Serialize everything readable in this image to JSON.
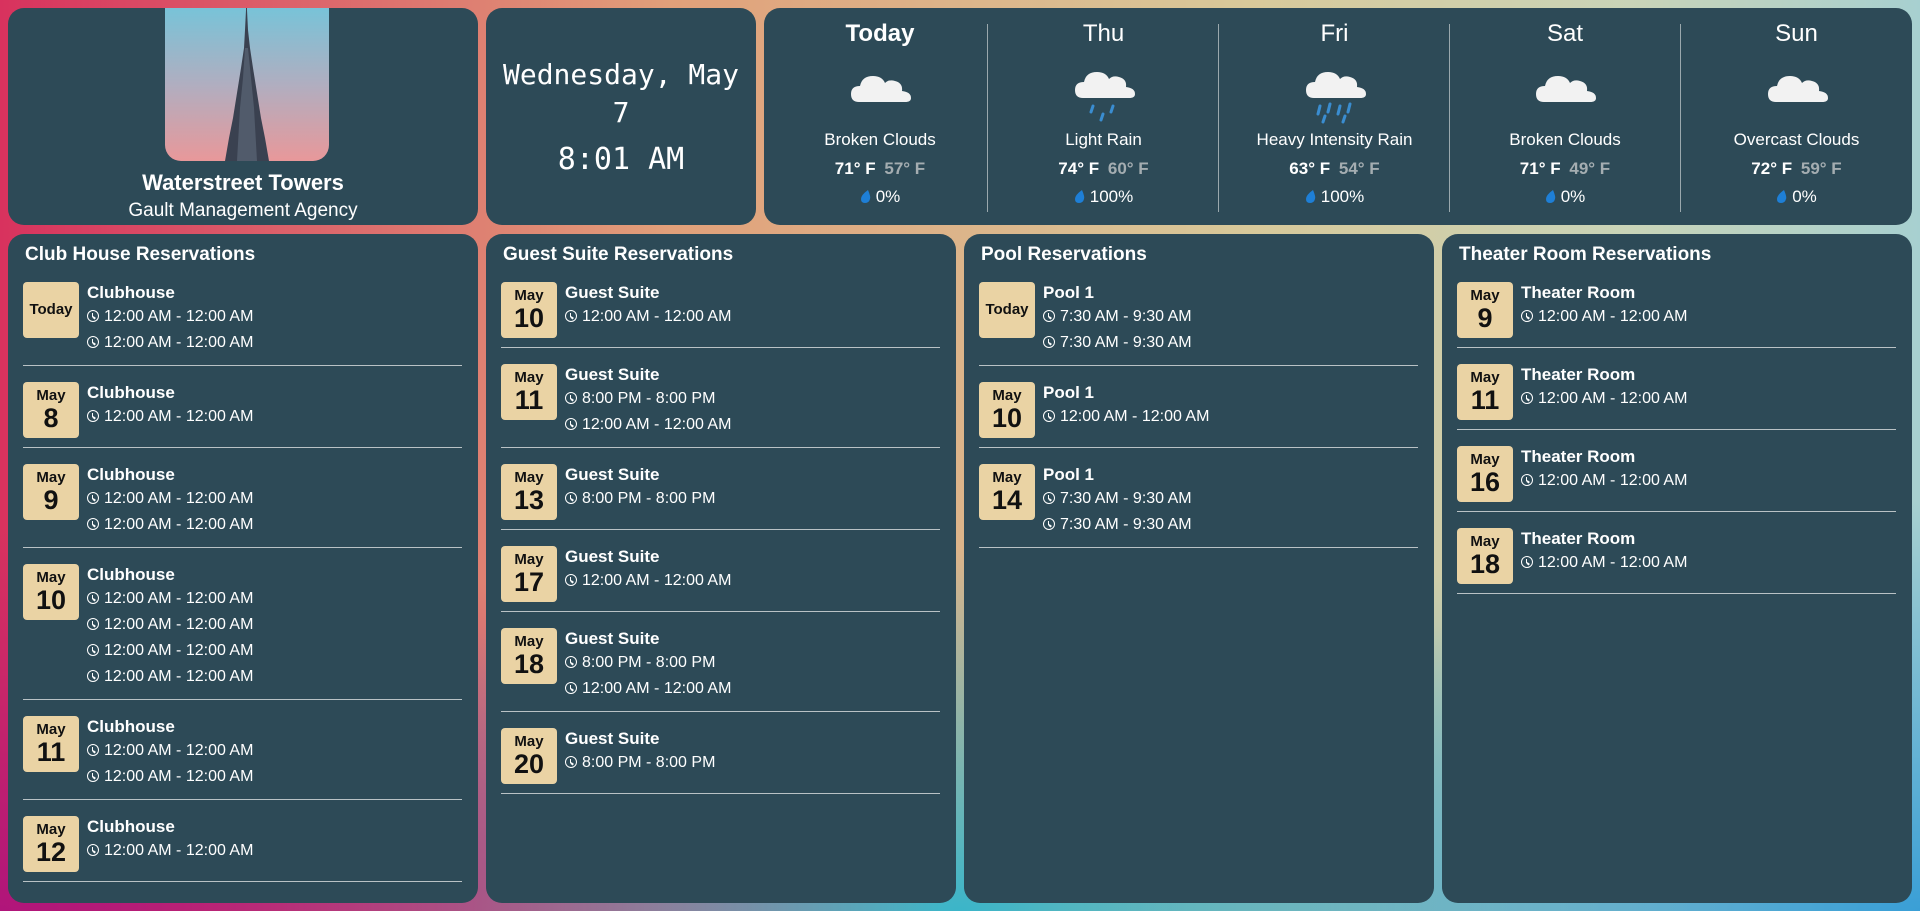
{
  "brand": {
    "name": "Waterstreet Towers",
    "agency": "Gault Management Agency"
  },
  "datetime": {
    "date": "Wednesday, May 7",
    "time": "8:01 AM"
  },
  "weather": {
    "forecast": [
      {
        "day": "Today",
        "icon": "broken-clouds",
        "condition": "Broken Clouds",
        "high": "71° F",
        "low": "57° F",
        "precip": "0%"
      },
      {
        "day": "Thu",
        "icon": "light-rain",
        "condition": "Light Rain",
        "high": "74° F",
        "low": "60° F",
        "precip": "100%"
      },
      {
        "day": "Fri",
        "icon": "heavy-rain",
        "condition": "Heavy Intensity Rain",
        "high": "63° F",
        "low": "54° F",
        "precip": "100%"
      },
      {
        "day": "Sat",
        "icon": "broken-clouds",
        "condition": "Broken Clouds",
        "high": "71° F",
        "low": "49° F",
        "precip": "0%"
      },
      {
        "day": "Sun",
        "icon": "overcast-clouds",
        "condition": "Overcast Clouds",
        "high": "72° F",
        "low": "59° F",
        "precip": "0%"
      }
    ]
  },
  "panels": [
    {
      "title": "Club House Reservations",
      "items": [
        {
          "today": "Today",
          "name": "Clubhouse",
          "times": [
            "12:00 AM - 12:00 AM",
            "12:00 AM - 12:00 AM"
          ]
        },
        {
          "month": "May",
          "day": "8",
          "name": "Clubhouse",
          "times": [
            "12:00 AM - 12:00 AM"
          ]
        },
        {
          "month": "May",
          "day": "9",
          "name": "Clubhouse",
          "times": [
            "12:00 AM - 12:00 AM",
            "12:00 AM - 12:00 AM"
          ]
        },
        {
          "month": "May",
          "day": "10",
          "name": "Clubhouse",
          "times": [
            "12:00 AM - 12:00 AM",
            "12:00 AM - 12:00 AM",
            "12:00 AM - 12:00 AM",
            "12:00 AM - 12:00 AM"
          ]
        },
        {
          "month": "May",
          "day": "11",
          "name": "Clubhouse",
          "times": [
            "12:00 AM - 12:00 AM",
            "12:00 AM - 12:00 AM"
          ]
        },
        {
          "month": "May",
          "day": "12",
          "name": "Clubhouse",
          "times": [
            "12:00 AM - 12:00 AM"
          ]
        }
      ]
    },
    {
      "title": "Guest Suite Reservations",
      "items": [
        {
          "month": "May",
          "day": "10",
          "name": "Guest Suite",
          "times": [
            "12:00 AM - 12:00 AM"
          ]
        },
        {
          "month": "May",
          "day": "11",
          "name": "Guest Suite",
          "times": [
            "8:00 PM - 8:00 PM",
            "12:00 AM - 12:00 AM"
          ]
        },
        {
          "month": "May",
          "day": "13",
          "name": "Guest Suite",
          "times": [
            "8:00 PM - 8:00 PM"
          ]
        },
        {
          "month": "May",
          "day": "17",
          "name": "Guest Suite",
          "times": [
            "12:00 AM - 12:00 AM"
          ]
        },
        {
          "month": "May",
          "day": "18",
          "name": "Guest Suite",
          "times": [
            "8:00 PM - 8:00 PM",
            "12:00 AM - 12:00 AM"
          ]
        },
        {
          "month": "May",
          "day": "20",
          "name": "Guest Suite",
          "times": [
            "8:00 PM - 8:00 PM"
          ]
        }
      ]
    },
    {
      "title": "Pool Reservations",
      "items": [
        {
          "today": "Today",
          "name": "Pool 1",
          "times": [
            "7:30 AM - 9:30 AM",
            "7:30 AM - 9:30 AM"
          ]
        },
        {
          "month": "May",
          "day": "10",
          "name": "Pool 1",
          "times": [
            "12:00 AM - 12:00 AM"
          ]
        },
        {
          "month": "May",
          "day": "14",
          "name": "Pool 1",
          "times": [
            "7:30 AM - 9:30 AM",
            "7:30 AM - 9:30 AM"
          ]
        }
      ]
    },
    {
      "title": "Theater Room Reservations",
      "items": [
        {
          "month": "May",
          "day": "9",
          "name": "Theater Room",
          "times": [
            "12:00 AM - 12:00 AM"
          ]
        },
        {
          "month": "May",
          "day": "11",
          "name": "Theater Room",
          "times": [
            "12:00 AM - 12:00 AM"
          ]
        },
        {
          "month": "May",
          "day": "16",
          "name": "Theater Room",
          "times": [
            "12:00 AM - 12:00 AM"
          ]
        },
        {
          "month": "May",
          "day": "18",
          "name": "Theater Room",
          "times": [
            "12:00 AM - 12:00 AM"
          ]
        }
      ]
    }
  ],
  "colors": {
    "card": "#2d4a57",
    "badge": "#ead3a4",
    "drop": "#1e7fd6",
    "low_temp": "#a4adb1"
  }
}
